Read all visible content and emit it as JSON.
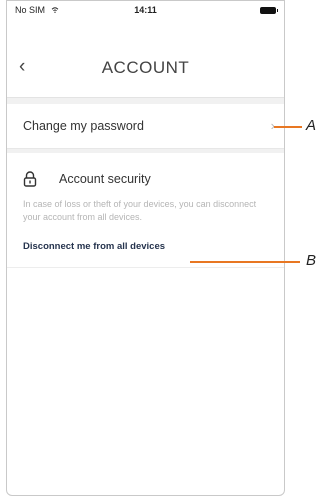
{
  "status_bar": {
    "carrier": "No SIM",
    "time": "14:11"
  },
  "header": {
    "title": "ACCOUNT",
    "back_glyph": "‹"
  },
  "password_row": {
    "label": "Change my password",
    "chevron_glyph": "›"
  },
  "account_security": {
    "title": "Account security",
    "description": "In case of loss or theft of your devices, you can disconnect your account from all devices.",
    "disconnect_link": "Disconnect me from all devices"
  },
  "callouts": {
    "a": "A",
    "b": "B"
  },
  "colors": {
    "callout": "#e87722",
    "link": "#26344e",
    "muted_text": "#b5b5b5"
  }
}
